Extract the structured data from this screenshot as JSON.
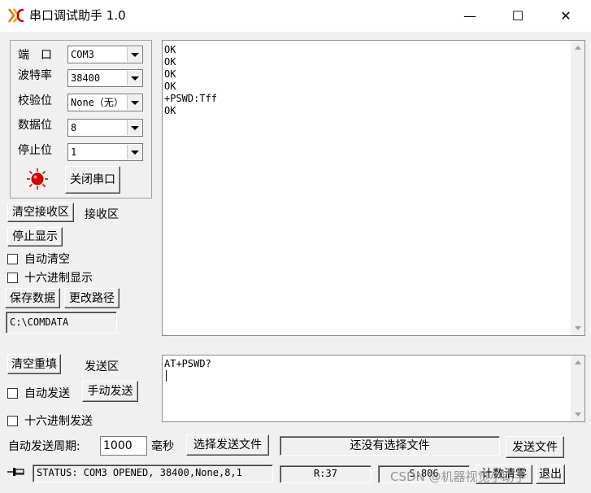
{
  "window": {
    "title": "串口调试助手 1.0",
    "icon": "app-logo-icon",
    "controls": {
      "minimize": "—",
      "maximize": "☐",
      "close": "✕"
    }
  },
  "port_settings": {
    "port": {
      "label": "端　口",
      "value": "COM3"
    },
    "baud": {
      "label": "波特率",
      "value": "38400"
    },
    "parity": {
      "label": "校验位",
      "value": "None（无）"
    },
    "data_bits": {
      "label": "数据位",
      "value": "8"
    },
    "stop_bits": {
      "label": "停止位",
      "value": "1"
    },
    "status_led_color": "#e00000",
    "close_port_label": "关闭串口"
  },
  "receive": {
    "clear_label": "清空接收区",
    "area_label": "接收区",
    "stop_display_label": "停止显示",
    "auto_clear_label": "自动清空",
    "hex_display_label": "十六进制显示",
    "save_data_label": "保存数据",
    "change_path_label": "更改路径",
    "path": "C:\\COMDATA",
    "lines": [
      "OK",
      "OK",
      "OK",
      "OK",
      "+PSWD:Tff",
      "OK"
    ]
  },
  "send": {
    "clear_label": "清空重填",
    "area_label": "发送区",
    "auto_send_label": "自动发送",
    "manual_send_label": "手动发送",
    "hex_send_label": "十六进制发送",
    "text": "AT+PSWD?",
    "period_label": "自动发送周期:",
    "period_value": "1000",
    "period_unit": "毫秒",
    "choose_file_label": "选择发送文件",
    "file_status": "还没有选择文件",
    "send_file_label": "发送文件"
  },
  "statusbar": {
    "pin_icon": "pin-icon",
    "status_text": "STATUS: COM3 OPENED, 38400,None,8,1",
    "rx_count": "R:37",
    "tx_count": "S:806",
    "reset_count_label": "计数清零",
    "exit_label": "退出",
    "watermark": "CSDN @机器视觉小助手"
  }
}
